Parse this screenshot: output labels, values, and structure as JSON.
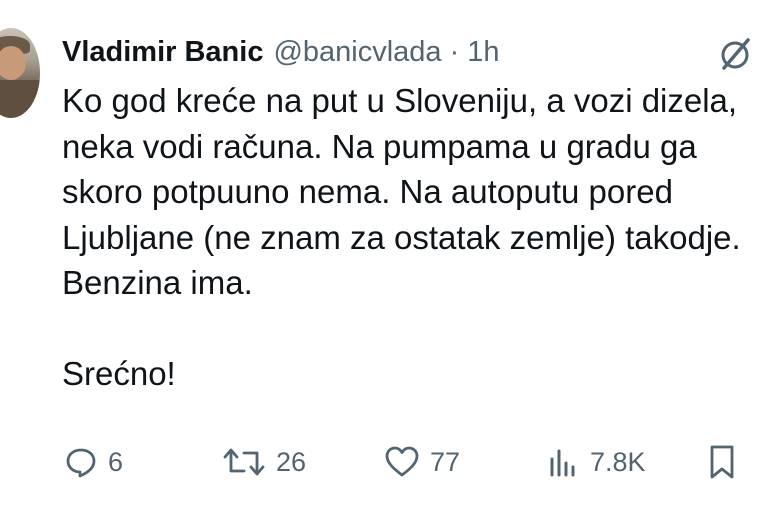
{
  "tweet": {
    "author_name": "Vladimir Banic",
    "author_handle": "@banicvlada",
    "separator": "·",
    "time": "1h",
    "lines": [
      "Ko god kreće na put u Sloveniju, a vozi dizela,",
      "neka vodi računa. Na pumpama u gradu ga",
      "skoro potpuuno nema. Na autoputu pored",
      "Ljubljane (ne znam za ostatak zemlje) takodje.",
      "Benzina ima."
    ],
    "closing": "Srećno!"
  },
  "actions": {
    "replies": "6",
    "reposts": "26",
    "likes": "77",
    "views": "7.8K"
  },
  "icons": {
    "grok": "grok-icon",
    "reply": "reply-icon",
    "repost": "repost-icon",
    "like": "heart-icon",
    "views": "views-icon",
    "bookmark": "bookmark-icon"
  },
  "colors": {
    "text": "#0f1419",
    "secondary": "#536471"
  }
}
